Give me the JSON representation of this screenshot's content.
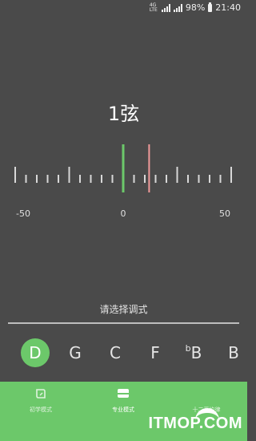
{
  "status_bar": {
    "network_top": "4G",
    "network_bottom": "LTE",
    "battery": "98%",
    "time": "21:40"
  },
  "string_title": "1弦",
  "scale": {
    "labels": {
      "left": "-50",
      "center": "0",
      "right": "50"
    },
    "reference_value": 0,
    "pitch_value": 12
  },
  "prompt": "请选择调式",
  "notes": [
    {
      "label": "D",
      "flat": "",
      "active": true
    },
    {
      "label": "G",
      "flat": "",
      "active": false
    },
    {
      "label": "C",
      "flat": "",
      "active": false
    },
    {
      "label": "F",
      "flat": "",
      "active": false
    },
    {
      "label": "B",
      "flat": "b",
      "active": false
    },
    {
      "label": "B",
      "flat": "",
      "active": false
    }
  ],
  "tabs": [
    {
      "label": "初学模式",
      "icon": "leaf-icon",
      "active": false
    },
    {
      "label": "专业模式",
      "icon": "card-icon",
      "active": true
    },
    {
      "label": "十二平均律",
      "icon": "arc-icon",
      "active": false
    }
  ],
  "watermark": "ITMOP.COM",
  "colors": {
    "accent": "#6cc86a",
    "pitch_line": "#f29a9a",
    "background": "#4a4a4a"
  }
}
